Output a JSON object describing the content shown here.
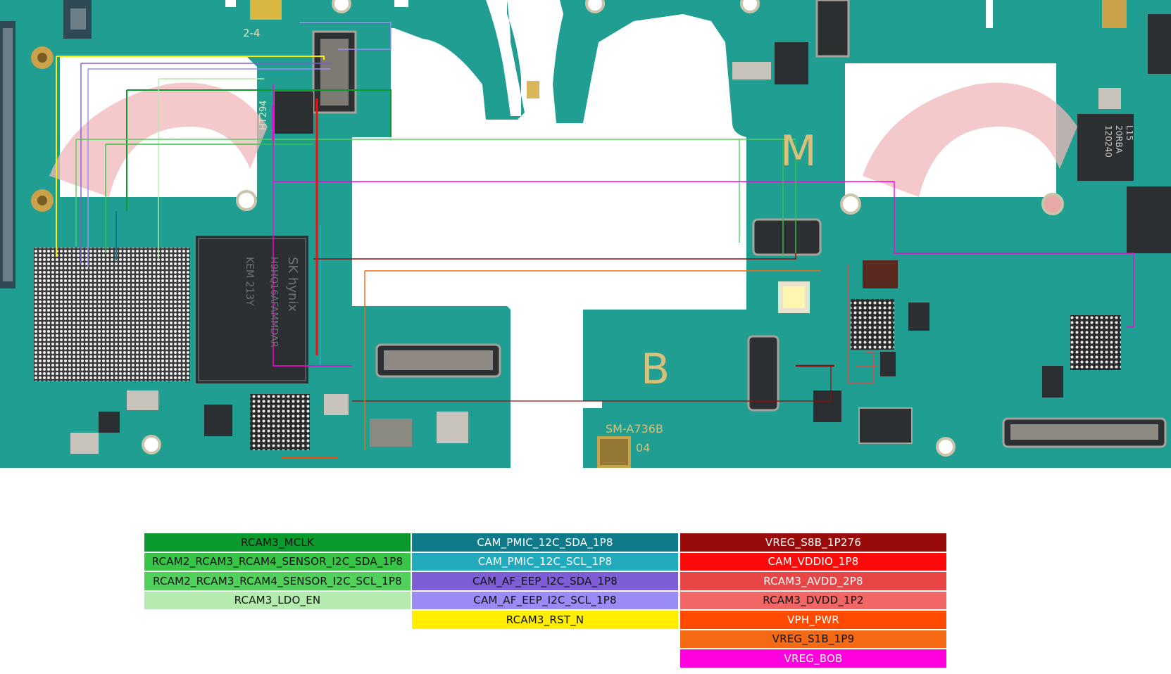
{
  "board": {
    "background_color": "#ffffff",
    "pcb_color": "#1f9e91",
    "pcb_dark_color": "#137266",
    "watermark_color": "#f0b7b9",
    "silkscreen": {
      "label_m": "M",
      "label_b": "B",
      "model": "SM-A736B",
      "revision": "04",
      "label_2_4": "2-4",
      "memory_brand": "SK hynix",
      "memory_part": "H9HQ16AFAMMDAR",
      "memory_code": "KEM 213Y",
      "pmic_marking_1": "L15",
      "pmic_marking_2": "20RBA",
      "pmic_marking_3": "120240",
      "small_ic_marking": "HT294"
    }
  },
  "legend": {
    "columns": [
      [
        {
          "label": "RCAM3_MCLK",
          "color": "#0a9a2e",
          "text_color": "#111111"
        },
        {
          "label": "RCAM2_RCAM3_RCAM4_SENSOR_I2C_SDA_1P8",
          "color": "#38c446",
          "text_color": "#111111"
        },
        {
          "label": "RCAM2_RCAM3_RCAM4_SENSOR_I2C_SCL_1P8",
          "color": "#52d05c",
          "text_color": "#111111"
        },
        {
          "label": "RCAM3_LDO_EN",
          "color": "#b4ecae",
          "text_color": "#111111"
        }
      ],
      [
        {
          "label": "CAM_PMIC_12C_SDA_1P8",
          "color": "#0f7a8a",
          "text_color": "#ffffff"
        },
        {
          "label": "CAM_PMIC_12C_SCL_1P8",
          "color": "#21aabb",
          "text_color": "#ffffff"
        },
        {
          "label": "CAM_AF_EEP_I2C_SDA_1P8",
          "color": "#7e5ed6",
          "text_color": "#111111"
        },
        {
          "label": "CAM_AF_EEP_I2C_SCL_1P8",
          "color": "#9b8cf5",
          "text_color": "#111111"
        },
        {
          "label": "RCAM3_RST_N",
          "color": "#ffee00",
          "text_color": "#111111"
        }
      ],
      [
        {
          "label": "VREG_S8B_1P276",
          "color": "#990a0a",
          "text_color": "#ffffff"
        },
        {
          "label": "CAM_VDDIO_1P8",
          "color": "#ff0a0a",
          "text_color": "#ffffff"
        },
        {
          "label": "RCAM3_AVDD_2P8",
          "color": "#e84646",
          "text_color": "#ffffff"
        },
        {
          "label": "RCAM3_DVDD_1P2",
          "color": "#f26666",
          "text_color": "#111111"
        },
        {
          "label": "VPH_PWR",
          "color": "#ff4a00",
          "text_color": "#ffffff"
        },
        {
          "label": "VREG_S1B_1P9",
          "color": "#f46a14",
          "text_color": "#111111"
        },
        {
          "label": "VREG_BOB",
          "color": "#ff00dd",
          "text_color": "#ffffff"
        }
      ]
    ]
  }
}
